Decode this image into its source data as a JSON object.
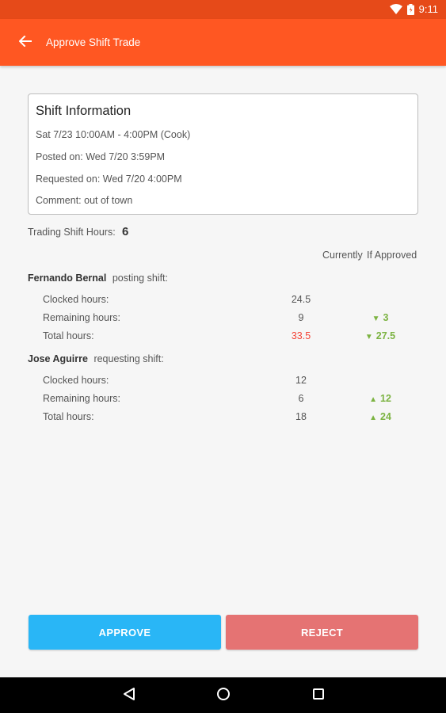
{
  "status_bar": {
    "time": "9:11"
  },
  "app_bar": {
    "title": "Approve Shift Trade"
  },
  "shift_info": {
    "title": "Shift Information",
    "shift": "Sat 7/23 10:00AM - 4:00PM (Cook)",
    "posted_on": "Posted on: Wed 7/20 3:59PM",
    "requested_on": "Requested on: Wed 7/20 4:00PM",
    "comment": "Comment: out of town"
  },
  "trading": {
    "label": "Trading Shift Hours:",
    "value": "6"
  },
  "columns": {
    "currently": "Currently",
    "if_approved": "If Approved"
  },
  "poster": {
    "name": "Fernando Bernal",
    "role": "posting shift:",
    "rows": [
      {
        "label": "Clocked hours:",
        "current": "24.5",
        "approved": "",
        "arrow": ""
      },
      {
        "label": "Remaining hours:",
        "current": "9",
        "approved": "3",
        "arrow": "▼"
      },
      {
        "label": "Total hours:",
        "current": "33.5",
        "approved": "27.5",
        "arrow": "▼"
      }
    ]
  },
  "requester": {
    "name": "Jose Aguirre",
    "role": "requesting shift:",
    "rows": [
      {
        "label": "Clocked hours:",
        "current": "12",
        "approved": "",
        "arrow": ""
      },
      {
        "label": "Remaining hours:",
        "current": "6",
        "approved": "12",
        "arrow": "▲"
      },
      {
        "label": "Total hours:",
        "current": "18",
        "approved": "24",
        "arrow": "▲"
      }
    ]
  },
  "actions": {
    "approve": "APPROVE",
    "reject": "REJECT"
  },
  "colors": {
    "app_bar": "#ff5722",
    "status_bar": "#e64a19",
    "approve": "#29b6f6",
    "reject": "#e57373",
    "increase": "#7cb342",
    "over_limit": "#f44336"
  },
  "icons": {
    "back": "arrow-left-icon",
    "wifi": "wifi-icon",
    "battery": "battery-icon",
    "nav_back": "nav-back-icon",
    "nav_home": "nav-home-icon",
    "nav_recents": "nav-recents-icon"
  }
}
